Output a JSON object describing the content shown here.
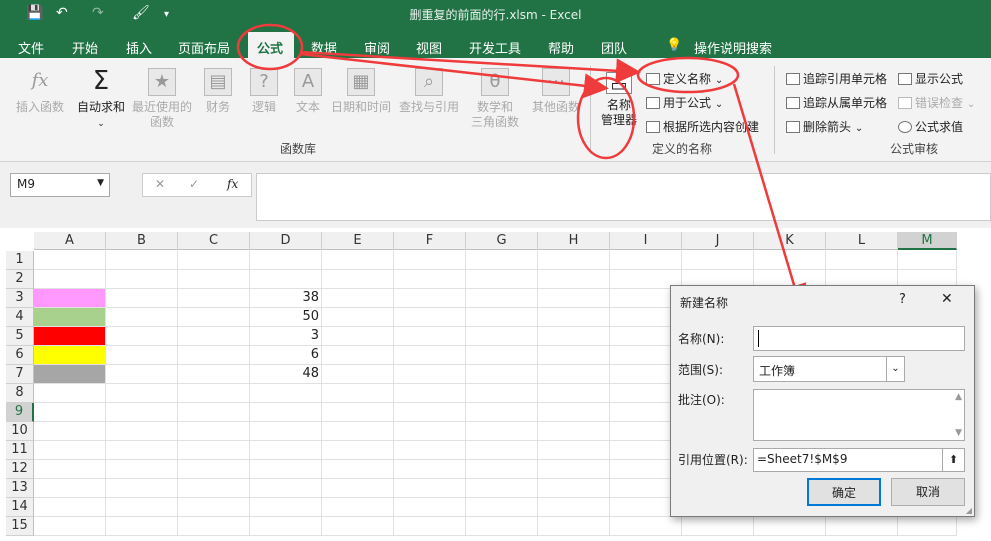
{
  "title": {
    "text": "删重复的前面的行.xlsm  -  Excel"
  },
  "tabs": [
    "文件",
    "开始",
    "插入",
    "页面布局",
    "公式",
    "数据",
    "审阅",
    "视图",
    "开发工具",
    "帮助",
    "团队"
  ],
  "tell_me": "操作说明搜索",
  "ribbon": {
    "insert_function": "插入函数",
    "autosum": "自动求和",
    "recent_1": "最近使用的",
    "recent_2": "函数",
    "finance": "财务",
    "logic": "逻辑",
    "text": "文本",
    "datetime": "日期和时间",
    "lookup": "查找与引用",
    "math_1": "数学和",
    "math_2": "三角函数",
    "other": "其他函数",
    "group_library": "函数库",
    "name_mgr_1": "名称",
    "name_mgr_2": "管理器",
    "define_name": "定义名称",
    "use_in_formula": "用于公式",
    "create_from_sel": "根据所选内容创建",
    "group_names": "定义的名称",
    "trace_precedents": "追踪引用单元格",
    "trace_dependents": "追踪从属单元格",
    "remove_arrows": "删除箭头",
    "show_formulas": "显示公式",
    "error_check": "错误检查",
    "evaluate": "公式求值",
    "group_audit": "公式审核"
  },
  "namebox": {
    "value": "M9"
  },
  "columns": [
    "A",
    "B",
    "C",
    "D",
    "E",
    "F",
    "G",
    "H",
    "I",
    "J",
    "K",
    "L",
    "M"
  ],
  "rows": [
    "1",
    "2",
    "3",
    "4",
    "5",
    "6",
    "7",
    "8",
    "9",
    "10",
    "11",
    "12",
    "13",
    "14",
    "15"
  ],
  "cells": {
    "d3": "38",
    "d4": "50",
    "d5": "3",
    "d6": "6",
    "d7": "48"
  },
  "colors": {
    "a3": "#ff99ff",
    "a4": "#a9d18e",
    "a5": "#ff0000",
    "a6": "#ffff00",
    "a7": "#a6a6a6",
    "excel_green": "#217346",
    "annotation": "#ef3b3b"
  },
  "dialog": {
    "title": "新建名称",
    "help": "?",
    "close": "✕",
    "name_label": "名称(N):",
    "name_value": "",
    "scope_label": "范围(S):",
    "scope_value": "工作簿",
    "comment_label": "批注(O):",
    "ref_label": "引用位置(R):",
    "ref_value": "=Sheet7!$M$9",
    "ok": "确定",
    "cancel": "取消"
  }
}
